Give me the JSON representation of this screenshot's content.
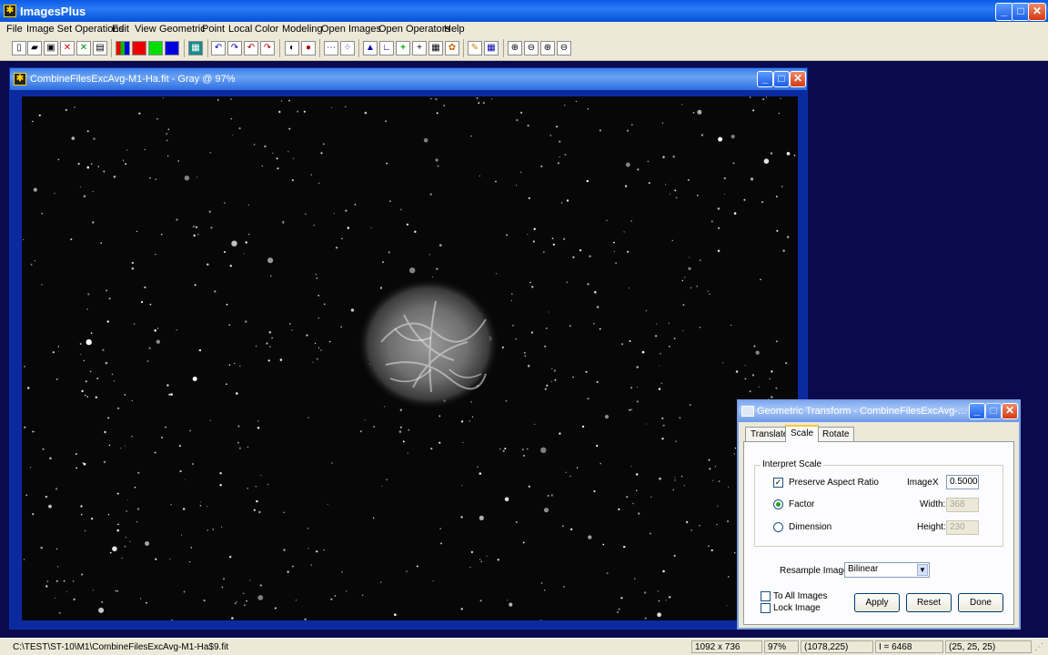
{
  "app": {
    "title": "ImagesPlus",
    "icon_name": "imagesplus-app-icon"
  },
  "menu": [
    "File",
    "Image Set Operations",
    "Edit",
    "View",
    "Geometric",
    "Point",
    "Local",
    "Color",
    "Modeling",
    "Open Images",
    "Open Operators",
    "Help"
  ],
  "toolbar": {
    "icons": [
      "new-icon",
      "open-icon",
      "save-icon",
      "close-red-icon",
      "close-green-icon",
      "print-icon",
      "rgb-channels-icon",
      "red-channel-icon",
      "green-channel-icon",
      "blue-channel-icon",
      "grid-icon",
      "undo-icon",
      "redo-icon",
      "undo-all-icon",
      "redo-all-icon",
      "mask-icon",
      "mask-fill-icon",
      "dots-icon",
      "scatter-icon",
      "histogram-icon",
      "curve-icon",
      "crosshair-icon",
      "crosshair-thin-icon",
      "calculator-icon",
      "palette-icon",
      "pencil-icon",
      "table-icon",
      "zoom-in-icon",
      "zoom-out-icon",
      "zoom-fit-icon",
      "zoom-actual-icon"
    ]
  },
  "image_window": {
    "title": "CombineFilesExcAvg-M1-Ha.fit - Gray @ 97%"
  },
  "dialog": {
    "title": "Geometric Transform - CombineFilesExcAvg-...",
    "tabs": [
      "Translate",
      "Scale",
      "Rotate"
    ],
    "active_tab": "Scale",
    "group_label": "Interpret Scale",
    "preserve_aspect_label": "Preserve Aspect Ratio",
    "preserve_aspect_checked": true,
    "image_label": "Image",
    "x_label": "X",
    "x_value": "0.5000",
    "factor_label": "Factor",
    "factor_selected": true,
    "dimension_label": "Dimension",
    "width_label": "Width:",
    "width_value": "368",
    "height_label": "Height:",
    "height_value": "230",
    "resample_label": "Resample Image:",
    "resample_value": "Bilinear",
    "to_all_images_label": "To All Images",
    "lock_image_label": "Lock Image",
    "apply_label": "Apply",
    "reset_label": "Reset",
    "done_label": "Done"
  },
  "status": {
    "path": "C:\\TEST\\ST-10\\M1\\CombineFilesExcAvg-M1-Ha$9.fit",
    "dimensions": "1092 x 736",
    "zoom": "97%",
    "coords": "(1078,225)",
    "intensity": "I = 6468",
    "rgb": "(25, 25, 25)"
  },
  "colors": {
    "xp_blue": "#0a5ae6",
    "mdi_background": "#0a0a4d",
    "image_frame": "#0c2aa0",
    "dialog_face": "#ece9d8"
  }
}
